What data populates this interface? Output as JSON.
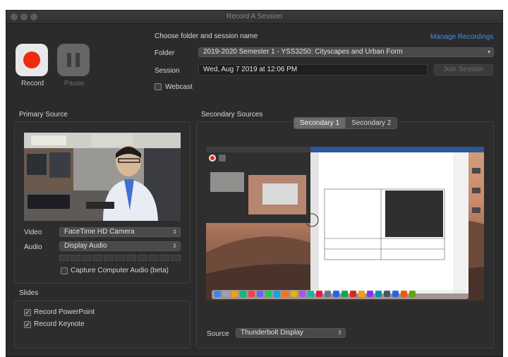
{
  "window": {
    "title": "Record A Session"
  },
  "controls": {
    "record_label": "Record",
    "pause_label": "Pause"
  },
  "session": {
    "heading": "Choose folder and session name",
    "manage_link": "Manage Recordings",
    "folder_label": "Folder",
    "folder_value": "2019-2020 Semester 1 - YSS3250: Cityscapes and Urban Form",
    "session_label": "Session",
    "session_value": "Wed, Aug 7 2019 at 12:06 PM",
    "join_button": "Join Session",
    "webcast_label": "Webcast",
    "webcast_checked": false
  },
  "primary": {
    "heading": "Primary Source",
    "video_label": "Video",
    "video_value": "FaceTime HD Camera",
    "audio_label": "Audio",
    "audio_value": "Display Audio",
    "capture_label": "Capture Computer Audio (beta)",
    "capture_checked": false
  },
  "slides": {
    "heading": "Slides",
    "powerpoint_label": "Record PowerPoint",
    "powerpoint_checked": true,
    "keynote_label": "Record Keynote",
    "keynote_checked": true
  },
  "secondary": {
    "heading": "Secondary Sources",
    "tabs": [
      "Secondary 1",
      "Secondary 2"
    ],
    "active_tab": 0,
    "source_label": "Source",
    "source_value": "Thunderbolt Display"
  },
  "colors": {
    "record_red": "#f0290f",
    "link_blue": "#3b8ff0",
    "window_bg": "#2b2b2c"
  }
}
